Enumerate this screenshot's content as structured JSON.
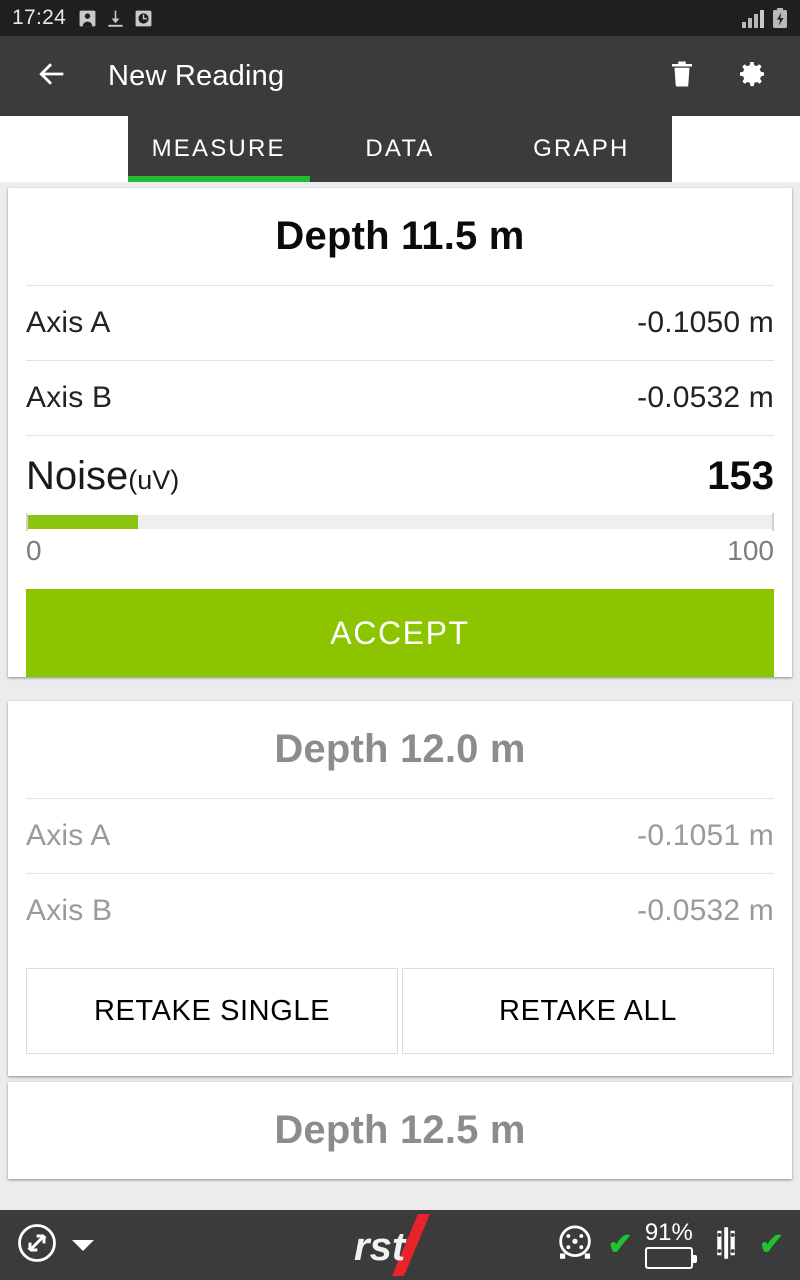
{
  "statusbar": {
    "time": "17:24",
    "icons": [
      "save-icon",
      "download-icon",
      "clock-icon"
    ],
    "signal_icon": "signal-bars-icon",
    "battery_icon": "battery-charging-icon"
  },
  "appbar": {
    "back_icon": "back-arrow-icon",
    "title": "New Reading",
    "delete_icon": "trash-icon",
    "settings_icon": "gear-icon"
  },
  "tabs": {
    "items": [
      {
        "label": "MEASURE",
        "active": true
      },
      {
        "label": "DATA",
        "active": false
      },
      {
        "label": "GRAPH",
        "active": false
      }
    ],
    "indicator_color": "#22bb33"
  },
  "active_reading": {
    "title": "Depth 11.5 m",
    "rows": [
      {
        "label": "Axis A",
        "value": "-0.1050 m"
      },
      {
        "label": "Axis B",
        "value": "-0.0532 m"
      }
    ],
    "noise": {
      "label": "Noise",
      "unit": "(uV)",
      "value": "153",
      "bar_percent": 15,
      "scale_min": "0",
      "scale_max": "100",
      "fill_color": "#8cc412"
    },
    "accept_label": "ACCEPT",
    "accept_color": "#8cc400"
  },
  "next_reading": {
    "title": "Depth 12.0 m",
    "rows": [
      {
        "label": "Axis A",
        "value": "-0.1051 m"
      },
      {
        "label": "Axis B",
        "value": "-0.0532 m"
      }
    ],
    "retake_single_label": "RETAKE SINGLE",
    "retake_all_label": "RETAKE ALL"
  },
  "upcoming_reading": {
    "title": "Depth 12.5 m"
  },
  "bottombar": {
    "expand_icon": "expand-arrows-circle-icon",
    "dropdown_icon": "chevron-down-icon",
    "logo_text": "rst",
    "logo_accent_color": "#e8232a",
    "reel_icon": "reel-status-icon",
    "reel_check": "✔",
    "battery_percent": "91%",
    "battery_level": 91,
    "probe_icon": "probe-status-icon",
    "probe_check": "✔",
    "status_color": "#21c131"
  }
}
